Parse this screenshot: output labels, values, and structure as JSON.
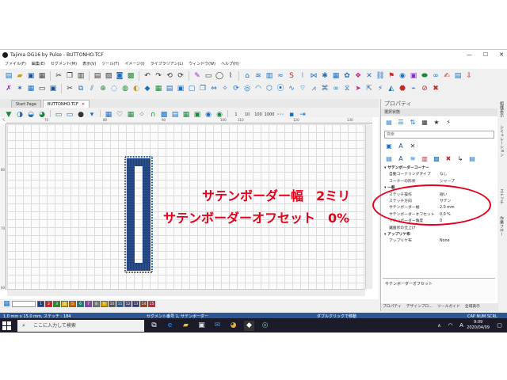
{
  "window": {
    "title": "Tajima DG16 by Pulse - BUTTONHO.TCF",
    "controls": [
      "—",
      "☐",
      "✕"
    ]
  },
  "menu": [
    "ファイル(F)",
    "編集(E)",
    "セグメント(M)",
    "表示(V)",
    "ツール(T)",
    "イメージ(I)",
    "ライブラリアン(L)",
    "ウィンドウ(W)",
    "ヘルプ(H)"
  ],
  "doc_tabs": [
    {
      "label": "Start Page",
      "close": ""
    },
    {
      "label": "BUTTONHO.TCF",
      "close": "✕"
    }
  ],
  "rulers": {
    "h_ticks": [
      "70",
      "80",
      "90",
      "100",
      "110",
      "120",
      "130"
    ],
    "v_ticks": [
      "80",
      "70",
      "60"
    ]
  },
  "properties": {
    "header": "プロパティ",
    "selector": "選択状態",
    "search_placeholder": "検索",
    "rows": [
      {
        "k": "▾ サテンボーダーコーナー",
        "v": "",
        "cat": true
      },
      {
        "k": "自動コーナリングタイプ",
        "v": "なし"
      },
      {
        "k": "コーナーの形状",
        "v": "シャープ"
      },
      {
        "k": "▾ 一般",
        "v": "",
        "cat": true
      },
      {
        "k": "ステッチ操作",
        "v": "短い"
      },
      {
        "k": "ステッチ方向",
        "v": "サテン"
      },
      {
        "k": "サテンボーダー幅",
        "v": "2.0 mm"
      },
      {
        "k": "サテンボーダーオフセット",
        "v": "0.0 %"
      },
      {
        "k": "サテンボーダー角度",
        "v": "0"
      },
      {
        "k": "鋸歯状の仕上げ",
        "v": ""
      },
      {
        "k": "▾ アップリケ布",
        "v": "",
        "cat": true
      },
      {
        "k": "アップリケ布",
        "v": "None"
      }
    ],
    "description": "サテンボーダーオフセット",
    "bottom_tabs": [
      "プロパティ",
      "デザインプロ…",
      "ツールガイド",
      "全域表示"
    ]
  },
  "side_tabs": [
    "組織表示",
    "シミュレーション",
    "ステッチ",
    "作業フロー"
  ],
  "color_swatches": [
    {
      "n": "1",
      "c": "#1f3a7a"
    },
    {
      "n": "2",
      "c": "#cc2222"
    },
    {
      "n": "3",
      "c": "#2a8a2a"
    },
    {
      "n": "4",
      "c": "#d8c020"
    },
    {
      "n": "5",
      "c": "#cc6600"
    },
    {
      "n": "6",
      "c": "#1a7a7a"
    },
    {
      "n": "7",
      "c": "#8844aa"
    },
    {
      "n": "8",
      "c": "#777777"
    },
    {
      "n": "9",
      "c": "#d8a800"
    },
    {
      "n": "10",
      "c": "#555555"
    },
    {
      "n": "11",
      "c": "#225588"
    },
    {
      "n": "12",
      "c": "#444488"
    },
    {
      "n": "13",
      "c": "#333366"
    },
    {
      "n": "14",
      "c": "#884422"
    },
    {
      "n": "15",
      "c": "#bb2233"
    }
  ],
  "status": {
    "left": "1.0 mm x 15.0 mm, ステッチ : 184",
    "mid": "セグメント番号 1, サテンボーダー",
    "right": "ダブルクリックで移動",
    "flags": "CAP  NUM  SCRL"
  },
  "annotations": {
    "line1": "サテンボーダー幅　2ミリ",
    "line2": "サテンボーダーオフセット　0%"
  },
  "taskbar": {
    "search_placeholder": "ここに入力して検索",
    "time": "9:09",
    "date": "2020/04/09",
    "lang": "A"
  }
}
